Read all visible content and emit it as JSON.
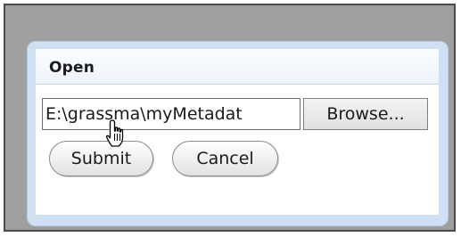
{
  "dialog": {
    "title": "Open",
    "file_path": "E:\\grassma\\myMetadat",
    "browse_label": "Browse...",
    "submit_label": "Submit",
    "cancel_label": "Cancel"
  },
  "colors": {
    "outer_background": "#9f9f9f",
    "panel_border": "#cfe0f4",
    "header_background": "#eef4fb"
  },
  "icons": {
    "cursor": "hand-pointer-icon"
  }
}
